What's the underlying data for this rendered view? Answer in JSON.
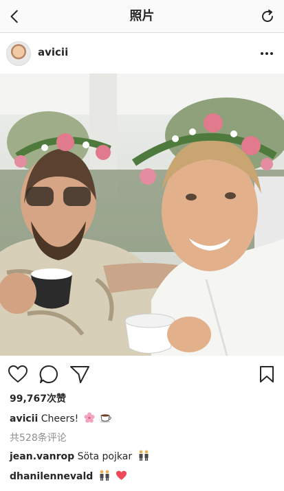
{
  "navbar": {
    "title": "照片",
    "back_icon": "chevron-left-icon",
    "refresh_icon": "refresh-icon"
  },
  "post": {
    "username": "avicii",
    "more_icon": "more-horizontal-icon",
    "likes": "99,767次赞",
    "caption_user": "avicii",
    "caption_text": "Cheers!",
    "caption_emojis": [
      "cherry-blossom-icon",
      "coffee-cup-icon"
    ],
    "view_comments": "共528条评论",
    "comments": [
      {
        "user": "jean.vanrop",
        "text": "Söta pojkar",
        "emojis": [
          "two-men-icon"
        ]
      },
      {
        "user": "dhanilennevald",
        "text": "",
        "emojis": [
          "two-men-icon",
          "red-heart-icon"
        ]
      }
    ]
  },
  "colors": {
    "text": "#262626",
    "secondary_text": "#8e8e8e",
    "divider": "#dbdbdb",
    "heart": "#ed4956"
  }
}
